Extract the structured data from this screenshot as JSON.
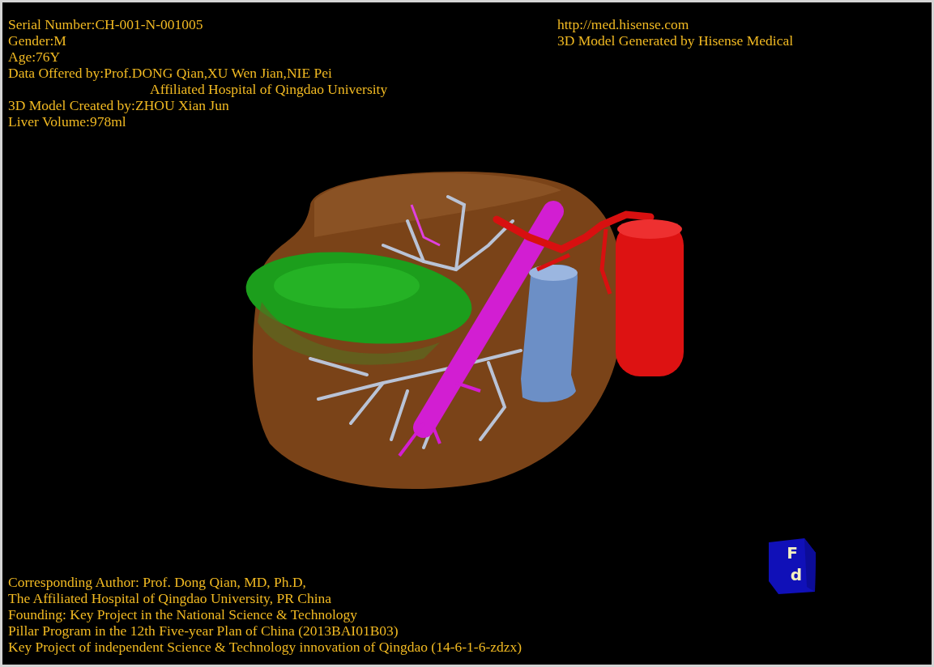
{
  "patient_info": [
    {
      "text": "Serial Number:CH-001-N-001005",
      "kind": "line"
    },
    {
      "text": "Gender:M",
      "kind": "line"
    },
    {
      "text": "Age:76Y",
      "kind": "line"
    },
    {
      "text": "Data Offered by:Prof.DONG Qian,XU Wen Jian,NIE Pei",
      "kind": "line"
    },
    {
      "text": "Affiliated Hospital of Qingdao University",
      "kind": "continuation"
    },
    {
      "text": "3D Model Created by:ZHOU Xian Jun",
      "kind": "line"
    },
    {
      "text": "Liver Volume:978ml",
      "kind": "line"
    }
  ],
  "credits": [
    "http://med.hisense.com",
    "3D Model Generated by Hisense Medical"
  ],
  "footer": [
    "Corresponding Author: Prof. Dong Qian, MD, Ph.D,",
    "The Affiliated Hospital of Qingdao University, PR China",
    "Founding: Key Project in the National Science & Technology",
    "Pillar Program in the 12th Five-year Plan of China (2013BAI01B03)",
    "Key Project of independent Science & Technology innovation of Qingdao (14-6-1-6-zdzx)"
  ],
  "orientation_cube": {
    "labels": [
      "F",
      "d"
    ]
  }
}
